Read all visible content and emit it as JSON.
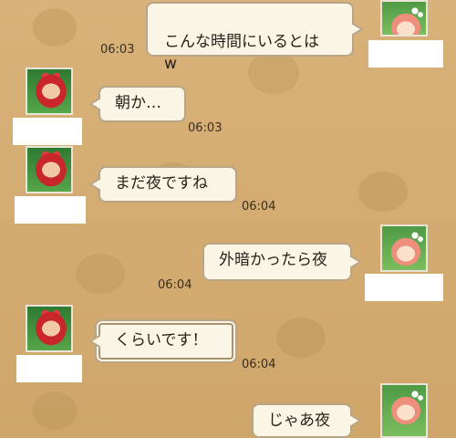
{
  "messages": [
    {
      "text": "こんな時間にいるとは\nw",
      "side": "right",
      "time": "06:03"
    },
    {
      "text": "朝か…",
      "side": "left",
      "time": "06:03"
    },
    {
      "text": "まだ夜ですね",
      "side": "left",
      "time": "06:04"
    },
    {
      "text": "外暗かったら夜",
      "side": "right",
      "time": "06:04"
    },
    {
      "text": "くらいです！",
      "side": "left",
      "time": "06:04"
    },
    {
      "text": "じゃあ夜",
      "side": "right",
      "time": ""
    }
  ],
  "avatars": {
    "left": "red-haired-character-avatar",
    "right": "pink-haired-character-avatar"
  }
}
